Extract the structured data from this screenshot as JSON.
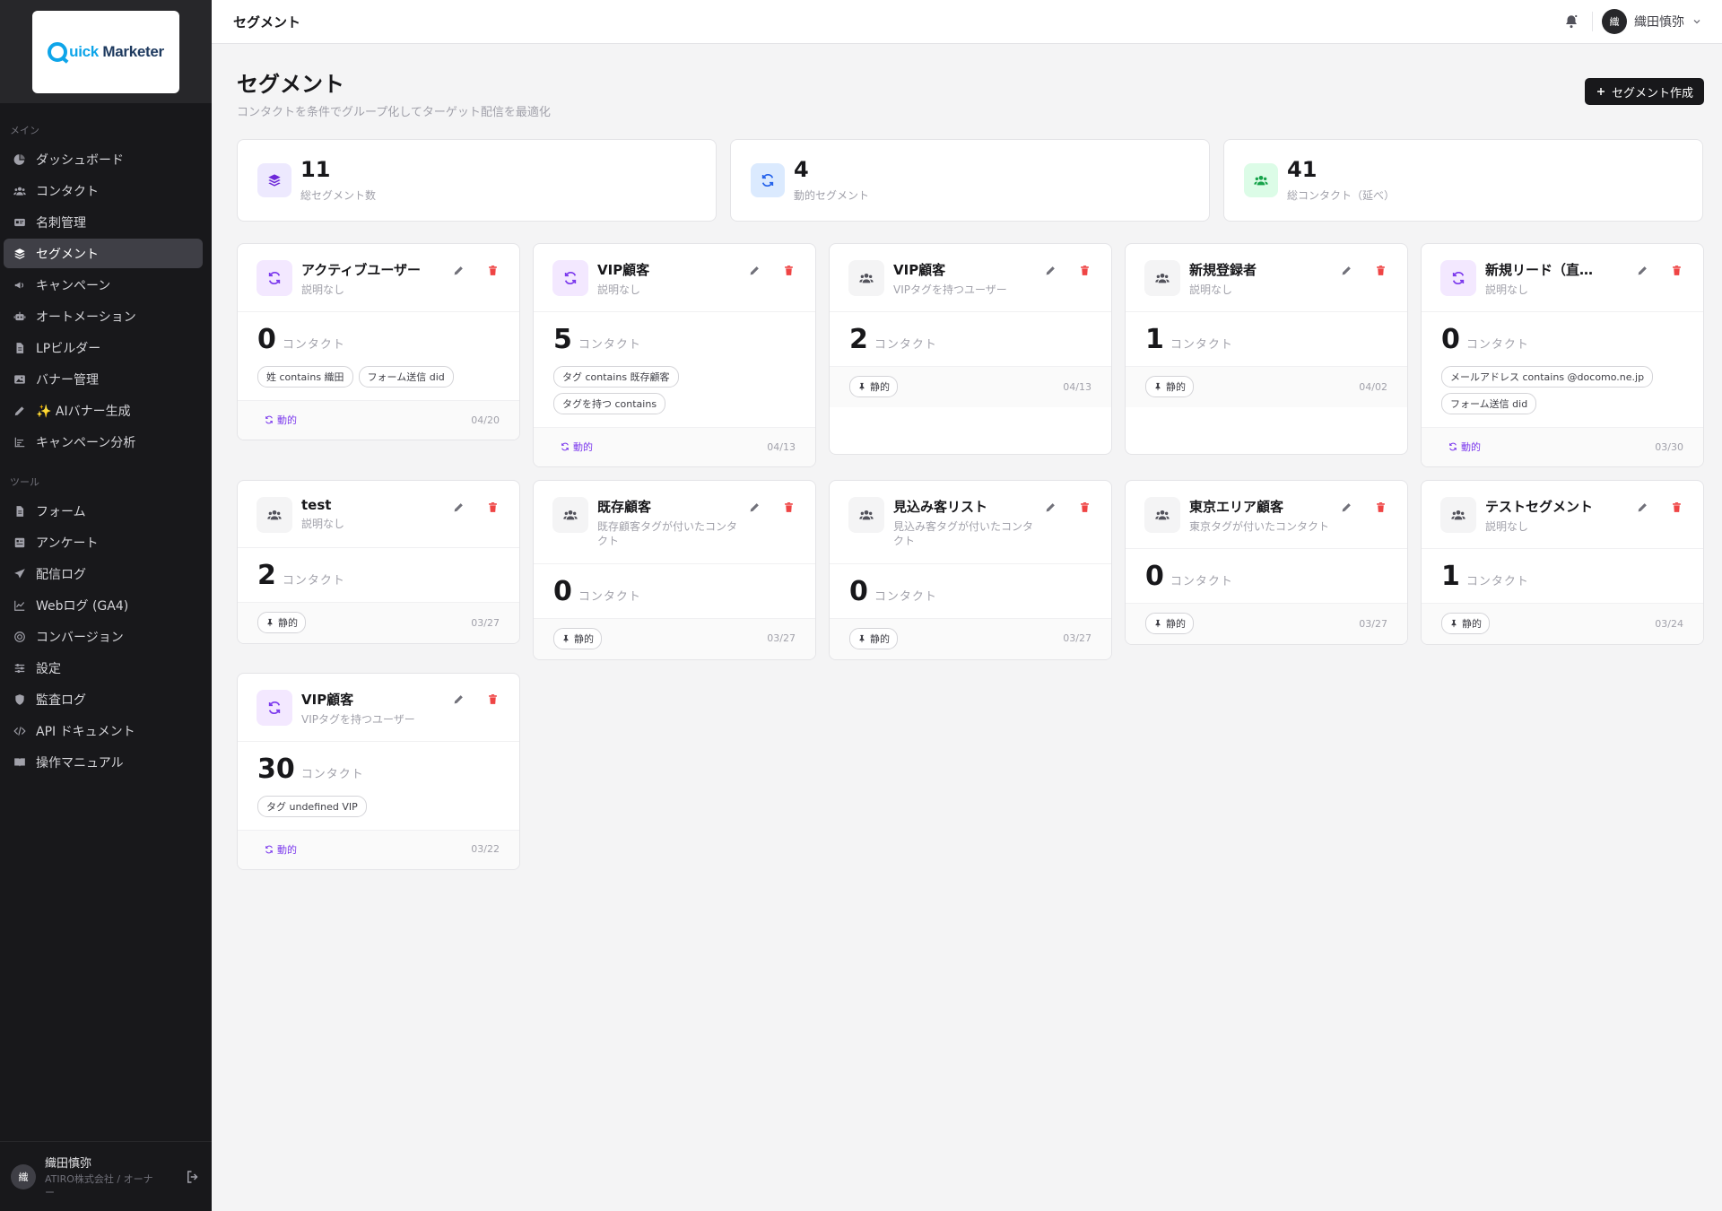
{
  "app": {
    "brand_q": "Q",
    "brand_uick": "uick",
    "brand_marketer": "Marketer"
  },
  "sidebar": {
    "section_main": "メイン",
    "main_items": [
      {
        "label": "ダッシュボード",
        "icon": "chart-pie-icon"
      },
      {
        "label": "コンタクト",
        "icon": "users-icon"
      },
      {
        "label": "名刺管理",
        "icon": "id-card-icon"
      },
      {
        "label": "セグメント",
        "icon": "layers-icon",
        "active": true
      },
      {
        "label": "キャンペーン",
        "icon": "megaphone-icon"
      },
      {
        "label": "オートメーション",
        "icon": "robot-icon"
      },
      {
        "label": "LPビルダー",
        "icon": "file-icon"
      },
      {
        "label": "バナー管理",
        "icon": "image-icon"
      },
      {
        "label": "✨ AIバナー生成",
        "icon": "pen-icon"
      },
      {
        "label": "キャンペーン分析",
        "icon": "bar-chart-icon"
      }
    ],
    "section_tools": "ツール",
    "tool_items": [
      {
        "label": "フォーム",
        "icon": "file-icon"
      },
      {
        "label": "アンケート",
        "icon": "survey-icon"
      },
      {
        "label": "配信ログ",
        "icon": "send-icon"
      },
      {
        "label": "Webログ (GA4)",
        "icon": "line-chart-icon"
      },
      {
        "label": "コンバージョン",
        "icon": "target-icon"
      },
      {
        "label": "設定",
        "icon": "sliders-icon"
      },
      {
        "label": "監査ログ",
        "icon": "shield-icon"
      },
      {
        "label": "API ドキュメント",
        "icon": "code-icon"
      },
      {
        "label": "操作マニュアル",
        "icon": "book-icon"
      }
    ],
    "footer": {
      "avatar": "織",
      "name": "織田慎弥",
      "org": "ATIRO株式会社 / オーナー"
    }
  },
  "topbar": {
    "title": "セグメント",
    "user_avatar": "織",
    "user_name": "織田慎弥"
  },
  "page": {
    "title": "セグメント",
    "subtitle": "コンタクトを条件でグループ化してターゲット配信を最適化",
    "create_button": "セグメント作成"
  },
  "stats": [
    {
      "value": "11",
      "label": "総セグメント数",
      "icon": "layers-icon",
      "bg": "#ede9fe",
      "color": "#6d28d9"
    },
    {
      "value": "4",
      "label": "動的セグメント",
      "icon": "refresh-icon",
      "bg": "#dbeafe",
      "color": "#2563eb"
    },
    {
      "value": "41",
      "label": "総コンタクト（延べ）",
      "icon": "users-icon",
      "bg": "#dcfce7",
      "color": "#16a34a"
    }
  ],
  "unit_label": "コンタクト",
  "segments": [
    {
      "name": "アクティブユーザー",
      "desc": "説明なし",
      "count": "0",
      "tags": [
        "姓 contains 織田",
        "フォーム送信 did"
      ],
      "type": "dynamic",
      "badge": "動的",
      "date": "04/20"
    },
    {
      "name": "VIP顧客",
      "desc": "説明なし",
      "count": "5",
      "tags": [
        "タグ contains 既存顧客",
        "タグを持つ contains"
      ],
      "type": "dynamic",
      "badge": "動的",
      "date": "04/13"
    },
    {
      "name": "VIP顧客",
      "desc": "VIPタグを持つユーザー",
      "count": "2",
      "tags": [],
      "type": "static",
      "badge": "静的",
      "date": "04/13"
    },
    {
      "name": "新規登録者",
      "desc": "説明なし",
      "count": "1",
      "tags": [],
      "type": "static",
      "badge": "静的",
      "date": "04/02"
    },
    {
      "name": "新規リード（直…",
      "desc": "説明なし",
      "count": "0",
      "tags": [
        "メールアドレス contains @docomo.ne.jp",
        "フォーム送信 did"
      ],
      "type": "dynamic",
      "badge": "動的",
      "date": "03/30"
    },
    {
      "name": "test",
      "desc": "説明なし",
      "count": "2",
      "tags": [],
      "type": "static",
      "badge": "静的",
      "date": "03/27"
    },
    {
      "name": "既存顧客",
      "desc": "既存顧客タグが付いたコンタクト",
      "count": "0",
      "tags": [],
      "type": "static",
      "badge": "静的",
      "date": "03/27"
    },
    {
      "name": "見込み客リスト",
      "desc": "見込み客タグが付いたコンタクト",
      "count": "0",
      "tags": [],
      "type": "static",
      "badge": "静的",
      "date": "03/27"
    },
    {
      "name": "東京エリア顧客",
      "desc": "東京タグが付いたコンタクト",
      "count": "0",
      "tags": [],
      "type": "static",
      "badge": "静的",
      "date": "03/27"
    },
    {
      "name": "テストセグメント",
      "desc": "説明なし",
      "count": "1",
      "tags": [],
      "type": "static",
      "badge": "静的",
      "date": "03/24"
    },
    {
      "name": "VIP顧客",
      "desc": "VIPタグを持つユーザー",
      "count": "30",
      "tags": [
        "タグ undefined VIP"
      ],
      "type": "dynamic",
      "badge": "動的",
      "date": "03/22"
    }
  ]
}
